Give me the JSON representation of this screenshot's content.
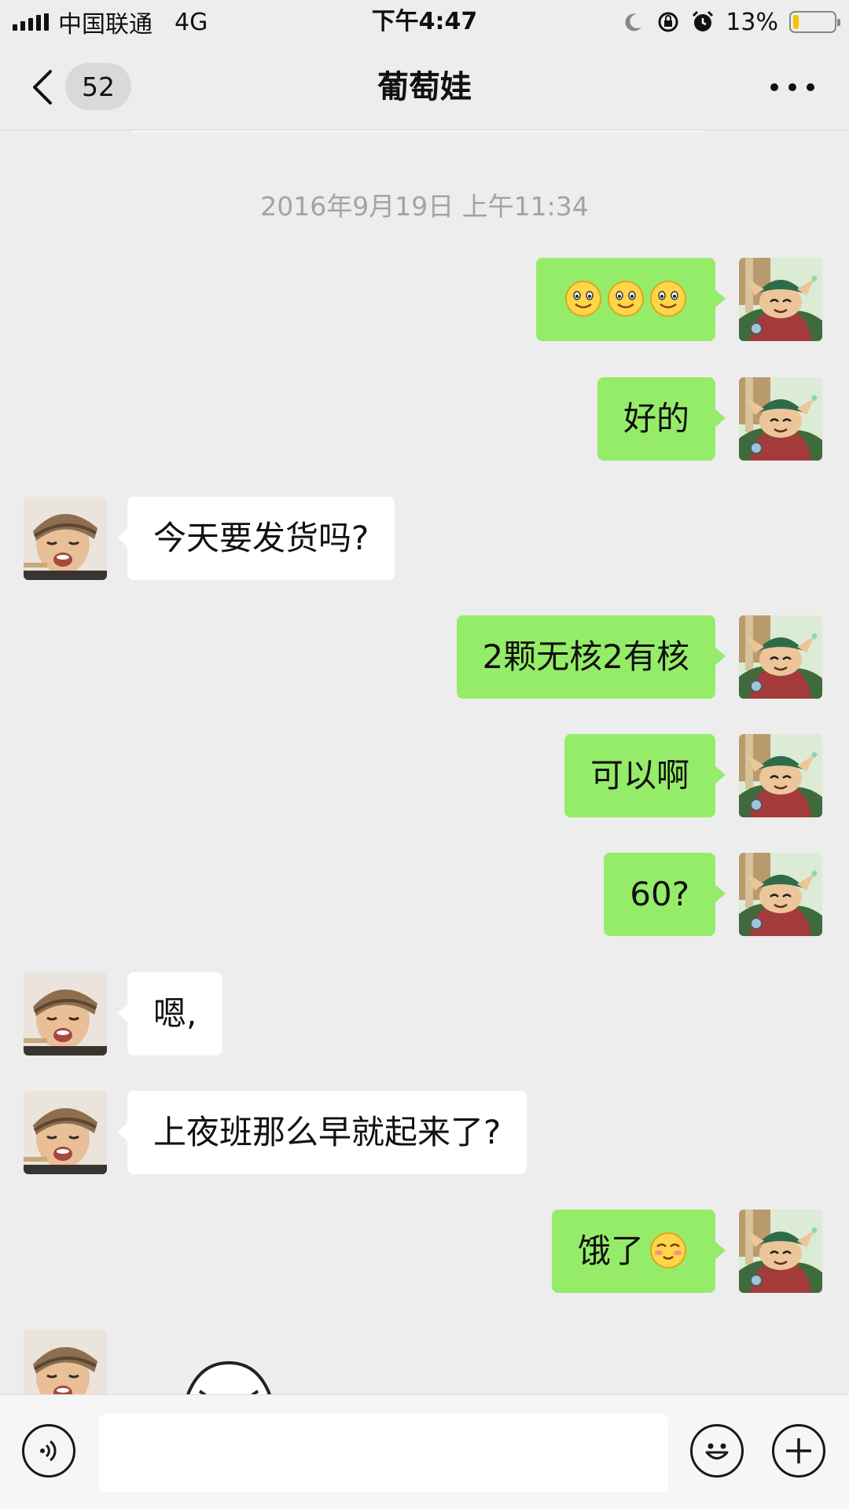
{
  "status_bar": {
    "carrier": "中国联通",
    "network": "4G",
    "time": "下午4:47",
    "battery": "13%",
    "battery_level": 0.13,
    "icons": [
      "signal-icon",
      "moon-icon",
      "rotation-lock-icon",
      "alarm-icon",
      "battery-icon"
    ]
  },
  "nav": {
    "unread_count": "52",
    "title": "葡萄娃",
    "icons": [
      "back-chevron-icon",
      "more-icon"
    ]
  },
  "chat": {
    "timestamp": "2016年9月19日 上午11:34",
    "messages": [
      {
        "direction": "out",
        "type": "emoji",
        "emoji": [
          "smile-emoji",
          "smile-emoji",
          "smile-emoji"
        ]
      },
      {
        "direction": "out",
        "type": "text",
        "text": "好的"
      },
      {
        "direction": "in",
        "type": "text",
        "text": "今天要发货吗?"
      },
      {
        "direction": "out",
        "type": "text",
        "text": "2颗无核2有核"
      },
      {
        "direction": "out",
        "type": "text",
        "text": "可以啊"
      },
      {
        "direction": "out",
        "type": "text",
        "text": "60?"
      },
      {
        "direction": "in",
        "type": "text",
        "text": "嗯,"
      },
      {
        "direction": "in",
        "type": "text",
        "text": "上夜班那么早就起来了?"
      },
      {
        "direction": "out",
        "type": "text",
        "text": "饿了",
        "emoji": "blush-emoji"
      },
      {
        "direction": "in",
        "type": "sticker",
        "sticker": "laughing-ghost-sticker"
      }
    ]
  },
  "input_bar": {
    "value": "",
    "icons": [
      "voice-icon",
      "emoji-icon",
      "plus-icon"
    ]
  },
  "colors": {
    "background": "#ededed",
    "outgoing_bubble": "#95ec69",
    "incoming_bubble": "#ffffff",
    "timestamp_text": "#a3a3a3",
    "battery_fill": "#f5c400"
  }
}
